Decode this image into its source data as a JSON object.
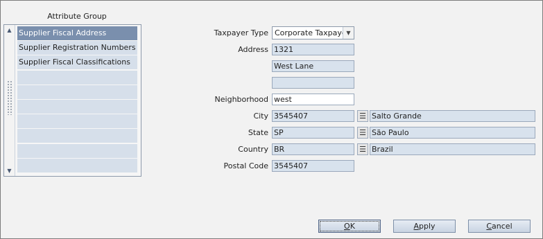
{
  "attribute_group": {
    "title": "Attribute Group",
    "items": [
      {
        "label": "Supplier Fiscal Address",
        "selected": true
      },
      {
        "label": "Supplier Registration Numbers",
        "selected": false
      },
      {
        "label": "Supplier Fiscal Classifications",
        "selected": false
      },
      {
        "label": "",
        "selected": false
      },
      {
        "label": "",
        "selected": false
      },
      {
        "label": "",
        "selected": false
      },
      {
        "label": "",
        "selected": false
      },
      {
        "label": "",
        "selected": false
      },
      {
        "label": "",
        "selected": false
      },
      {
        "label": "",
        "selected": false
      }
    ]
  },
  "form": {
    "taxpayer_type": {
      "label": "Taxpayer Type",
      "value": "Corporate Taxpayer"
    },
    "address": {
      "label": "Address",
      "line1": "1321",
      "line2": "West Lane",
      "line3": ""
    },
    "neighborhood": {
      "label": "Neighborhood",
      "value": "west"
    },
    "city": {
      "label": "City",
      "code": "3545407",
      "name": "Salto Grande"
    },
    "state": {
      "label": "State",
      "code": "SP",
      "name": "São Paulo"
    },
    "country": {
      "label": "Country",
      "code": "BR",
      "name": "Brazil"
    },
    "postal_code": {
      "label": "Postal Code",
      "value": "3545407"
    }
  },
  "buttons": {
    "ok": {
      "first": "O",
      "rest": "K"
    },
    "apply": {
      "first": "A",
      "rest": "pply"
    },
    "cancel": {
      "first": "C",
      "rest": "ancel"
    }
  },
  "icons": {
    "lov": "list-of-values-icon",
    "dropdown": "chevron-down-icon"
  }
}
